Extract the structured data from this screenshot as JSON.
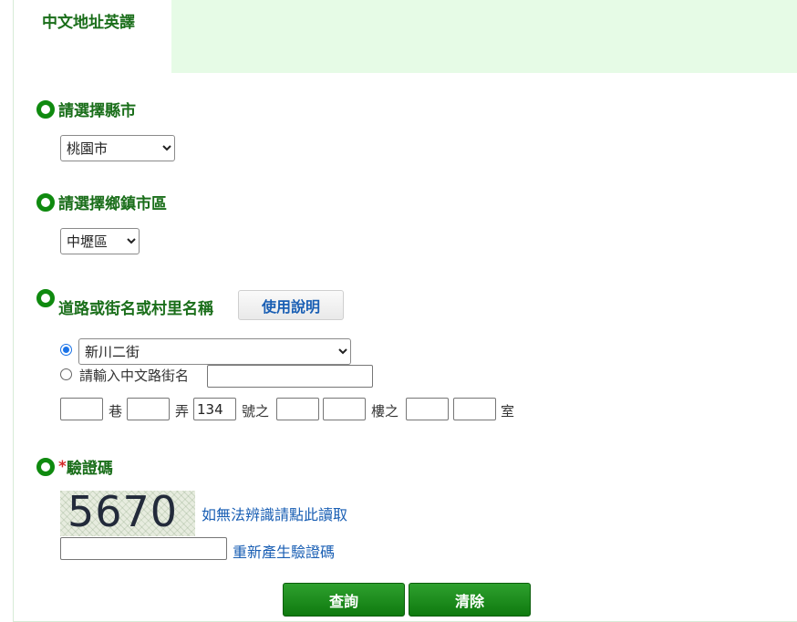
{
  "page": {
    "tab_title": "中文地址英譯",
    "accent_color": "#0f8a0f",
    "tab_bg_color": "#e6fbe6"
  },
  "county": {
    "label": "請選擇縣市",
    "selected": "桃園市"
  },
  "district": {
    "label": "請選擇鄉鎮市區",
    "selected": "中壢區"
  },
  "road": {
    "label": "道路或街名或村里名稱",
    "help_button": "使用說明",
    "select_option_selected": true,
    "selected_road": "新川二街",
    "manual_label": "請輸入中文路街名",
    "manual_value": ""
  },
  "address": {
    "lane_value": "",
    "lane_unit": "巷",
    "alley_value": "",
    "alley_unit": "弄",
    "number_value": "134",
    "number_unit": "號之",
    "number_sub_value": "",
    "floor_value": "",
    "floor_unit": "樓之",
    "floor_sub_value": "",
    "room_value": "",
    "room_unit": "室"
  },
  "captcha": {
    "required_mark": "*",
    "label": "驗證碼",
    "image_text": "5670",
    "audio_link": "如無法辨識請點此讀取",
    "input_value": "",
    "refresh_link": "重新產生驗證碼"
  },
  "actions": {
    "search": "查詢",
    "clear": "清除"
  }
}
